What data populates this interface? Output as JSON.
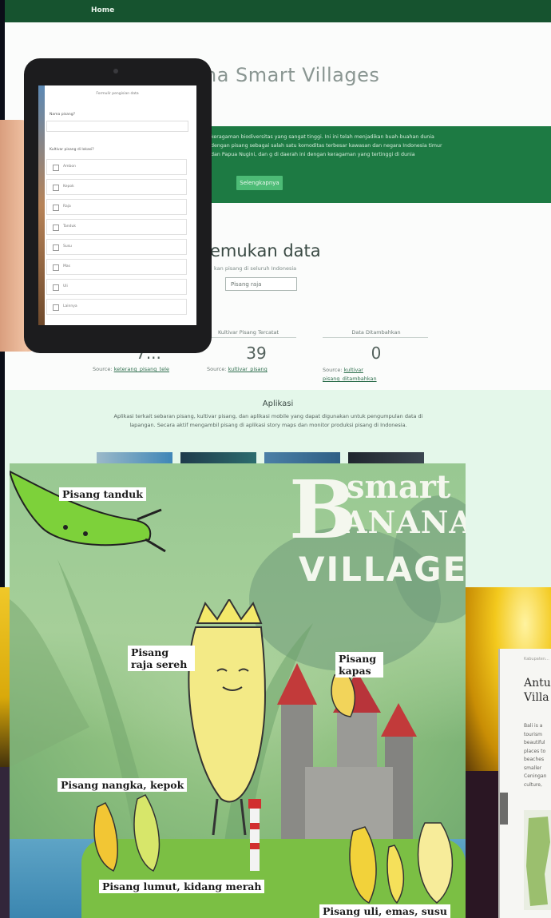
{
  "website": {
    "nav_home": "Home",
    "title": "na Smart Villages",
    "hero_text": "keragaman biodiversitas yang sangat tinggi. Ini ini telah menjadikan buah-buahan dunia dengan pisang sebagai salah satu komoditas terbesar kawasan dan negara Indonesia timur dan Papua Nugini, dan g di daerah ini dengan keragaman yang tertinggi di dunia",
    "hero_button": "Selengkapnya",
    "find_title": "emukan data",
    "find_sub": "kan pisang di seluruh Indonesia",
    "search_value": "Pisang raja",
    "stats": [
      {
        "label": "",
        "value": "7...",
        "source_prefix": "Source:",
        "source_link": "keterang_pisang_tele"
      },
      {
        "label": "Kultivar Pisang Tercatat",
        "value": "39",
        "source_prefix": "Source:",
        "source_link": "kultivar_pisang"
      },
      {
        "label": "Data Ditambahkan",
        "value": "0",
        "source_prefix": "Source:",
        "source_link": "kultivar pisang_ditambahkan"
      }
    ],
    "aplikasi_title": "Aplikasi",
    "aplikasi_text": "Aplikasi terkait sebaran pisang, kultivar pisang, dan aplikasi mobile yang dapat digunakan untuk pengumpulan data di lapangan. Secara aktif mengambil pisang di aplikasi story maps dan monitor produksi pisang di Indonesia."
  },
  "tablet": {
    "form_title": "Formulir pengisian data",
    "field_1_label": "Nama pisang?",
    "field_2_label": "Kultivar pisang di lokasi?",
    "options": [
      "Ambon",
      "Kepok",
      "Raja",
      "Tanduk",
      "Susu",
      "Mas",
      "Uli",
      "Lainnya"
    ]
  },
  "poster": {
    "title_letter": "B",
    "title_top": "smart",
    "title_bottom": "ANANA",
    "subtitle": "VILLAGE",
    "labels": {
      "tanduk": "Pisang tanduk",
      "raja_sereh": "Pisang raja sereh",
      "kapas": "Pisang kapas",
      "nangka_kepok": "Pisang nangka, kepok",
      "lumut": "Pisang lumut, kidang merah",
      "uli": "Pisang uli, emas, susu"
    }
  },
  "blog_card": {
    "breadcrumb": "Kabupaten...",
    "title": "Antu\nVilla",
    "body": "Bali is a\ntourism\nbeautiful\nplaces to\nbeaches\nsmaller\nCeningan\nculture,"
  },
  "colors": {
    "site_green_dark": "#16532f",
    "site_green": "#1d7a43",
    "button_green": "#4dbb76",
    "aplikasi_bg": "#e4f7ea",
    "poster_green": "#8dbf7f"
  }
}
